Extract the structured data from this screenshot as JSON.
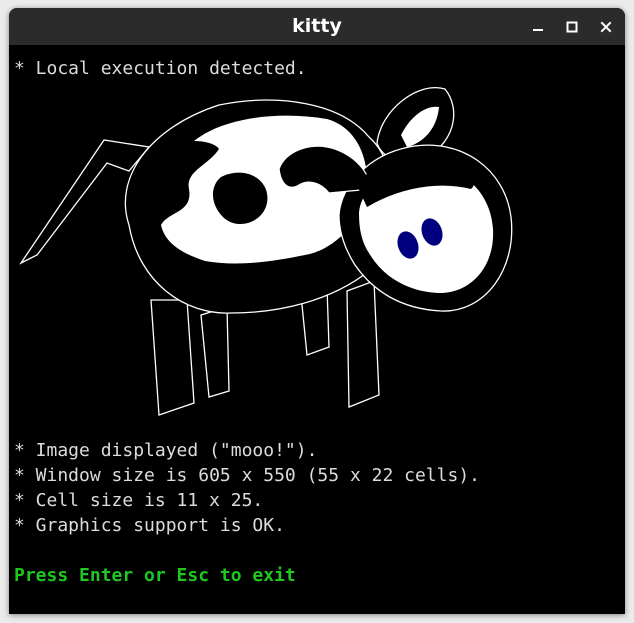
{
  "window": {
    "title": "kitty",
    "controls": {
      "minimize_icon": "minimize-icon",
      "maximize_icon": "maximize-icon",
      "close_icon": "close-icon"
    }
  },
  "terminal": {
    "lines": [
      "* Local execution detected.",
      "* Image displayed (\"mooo!\").",
      "* Window size is 605 x 550 (55 x 22 cells).",
      "* Cell size is 11 x 25.",
      "* Graphics support is OK."
    ],
    "prompt": "Press Enter or Esc to exit",
    "image": "cow-image"
  },
  "colors": {
    "background": "#000000",
    "text": "#dcdcdc",
    "prompt": "#1ec81e",
    "titlebar": "#2b2b2b",
    "cow_eyes": "#00007f"
  }
}
